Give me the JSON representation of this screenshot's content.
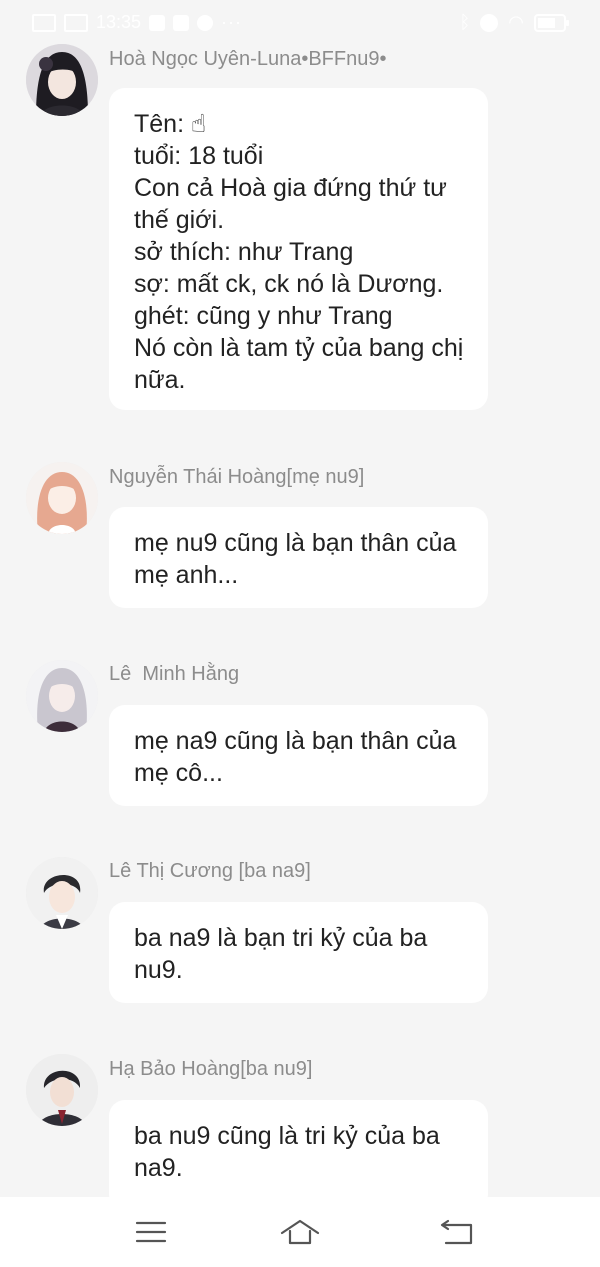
{
  "status_bar": {
    "time": "13:35",
    "battery_level_percent": 70,
    "icons": [
      "signal-icon",
      "signal-icon",
      "facebook-icon",
      "app-icon",
      "messenger-icon",
      "more-dots-icon",
      "bluetooth-icon",
      "vibrate-icon",
      "wifi-icon",
      "battery-icon"
    ],
    "more_dots": "···"
  },
  "messages": [
    {
      "sender": "Hoà Ngọc Uyên-Luna•BFFnu9•",
      "avatar": "avatar-dark-hair-girl",
      "text": "Tên: ☝\ntuổi: 18 tuổi\nCon cả Hoà gia đứng thứ tư thế giới.\nsở thích: như Trang\nsợ: mất ck, ck nó là Dương.\nghét: cũng y như Trang\nNó còn là tam tỷ của bang chị nữa."
    },
    {
      "sender": "Nguyễn Thái Hoàng[mẹ nu9]",
      "avatar": "avatar-pink-hair-girl",
      "text": "mẹ nu9 cũng là bạn thân của mẹ anh..."
    },
    {
      "sender": "Lê  Minh Hằng",
      "avatar": "avatar-silver-hair-girl",
      "text": "mẹ na9 cũng là bạn thân của mẹ cô..."
    },
    {
      "sender": "Lê Thị Cương [ba na9]",
      "avatar": "avatar-dark-hair-boy",
      "text": "ba na9 là bạn tri kỷ của ba nu9."
    },
    {
      "sender": "Hạ Bảo Hoàng[ba nu9]",
      "avatar": "avatar-suit-man",
      "text": "ba nu9 cũng là tri kỷ của ba na9."
    }
  ],
  "nav_bar": {
    "items": [
      "menu-icon",
      "home-icon",
      "back-icon"
    ]
  },
  "colors": {
    "background": "#f5f5f5",
    "bubble": "#ffffff",
    "sender_text": "#8c8c8c",
    "message_text": "#222222"
  }
}
